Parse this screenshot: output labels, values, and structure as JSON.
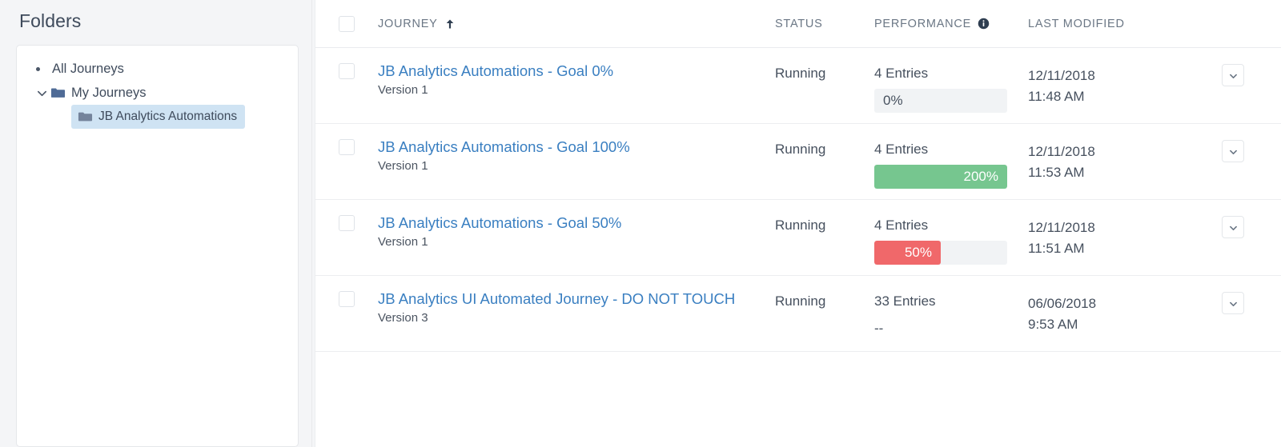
{
  "sidebar": {
    "title": "Folders",
    "tree": [
      {
        "label": "All Journeys",
        "level": 0,
        "icon": "bullet",
        "selected": false
      },
      {
        "label": "My Journeys",
        "level": 1,
        "icon": "folder-open-icon",
        "chevron": "chevron-down-icon",
        "selected": false
      },
      {
        "label": "JB Analytics Automations",
        "level": 2,
        "icon": "folder-closed-icon",
        "selected": true
      }
    ]
  },
  "table": {
    "columns": {
      "journey": "JOURNEY",
      "status": "STATUS",
      "performance": "PERFORMANCE",
      "last_modified": "LAST MODIFIED"
    },
    "sort": {
      "column": "JOURNEY",
      "direction": "ascending",
      "glyph": "↑"
    },
    "rows": [
      {
        "title": "JB Analytics Automations - Goal 0%",
        "version": "Version 1",
        "status": "Running",
        "entries": "4 Entries",
        "performance": "0%",
        "performance_fill_percent": 0,
        "performance_bar": true,
        "performance_color": "#f1f3f5",
        "date": "12/11/2018",
        "time": "11:48 AM"
      },
      {
        "title": "JB Analytics Automations - Goal 100%",
        "version": "Version 1",
        "status": "Running",
        "entries": "4 Entries",
        "performance": "200%",
        "performance_fill_percent": 100,
        "performance_bar": true,
        "performance_color": "#76c68f",
        "date": "12/11/2018",
        "time": "11:53 AM"
      },
      {
        "title": "JB Analytics Automations - Goal 50%",
        "version": "Version 1",
        "status": "Running",
        "entries": "4 Entries",
        "performance": "50%",
        "performance_fill_percent": 50,
        "performance_bar": true,
        "performance_color": "#f0686a",
        "date": "12/11/2018",
        "time": "11:51 AM"
      },
      {
        "title": "JB Analytics UI Automated Journey - DO NOT TOUCH",
        "version": "Version 3",
        "status": "Running",
        "entries": "33 Entries",
        "performance": "--",
        "performance_fill_percent": 0,
        "performance_bar": false,
        "performance_color": "",
        "date": "06/06/2018",
        "time": "9:53 AM"
      }
    ]
  },
  "colors": {
    "link": "#3a7fc1",
    "selected_folder": "#cfe3f3",
    "good": "#76c68f",
    "bad": "#f0686a",
    "track": "#f1f3f5"
  }
}
